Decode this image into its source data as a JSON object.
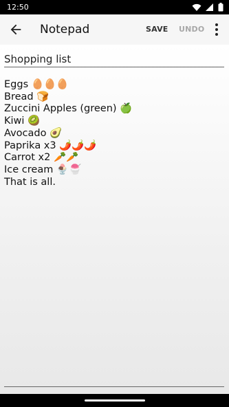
{
  "status_bar": {
    "time": "12:50"
  },
  "app_bar": {
    "title": "Notepad",
    "save_label": "SAVE",
    "undo_label": "UNDO"
  },
  "note": {
    "title": "Shopping list",
    "lines": [
      "Eggs 🥚🥚🥚",
      "Bread 🍞",
      "Zuccini Apples (green) 🍏",
      "Kiwi 🥝",
      "Avocado 🥑",
      "Paprika x3 🌶️🌶️🌶️",
      "Carrot x2 🥕🥕",
      "Ice cream 🍨🍧",
      "That is all."
    ]
  },
  "colors": {
    "app_bar_bg": "#f6f6f6",
    "undo_disabled": "#a8a8a8"
  },
  "icons": [
    "wifi-icon",
    "signal-icon",
    "battery-icon",
    "arrow-back-icon",
    "more-vert-icon"
  ]
}
